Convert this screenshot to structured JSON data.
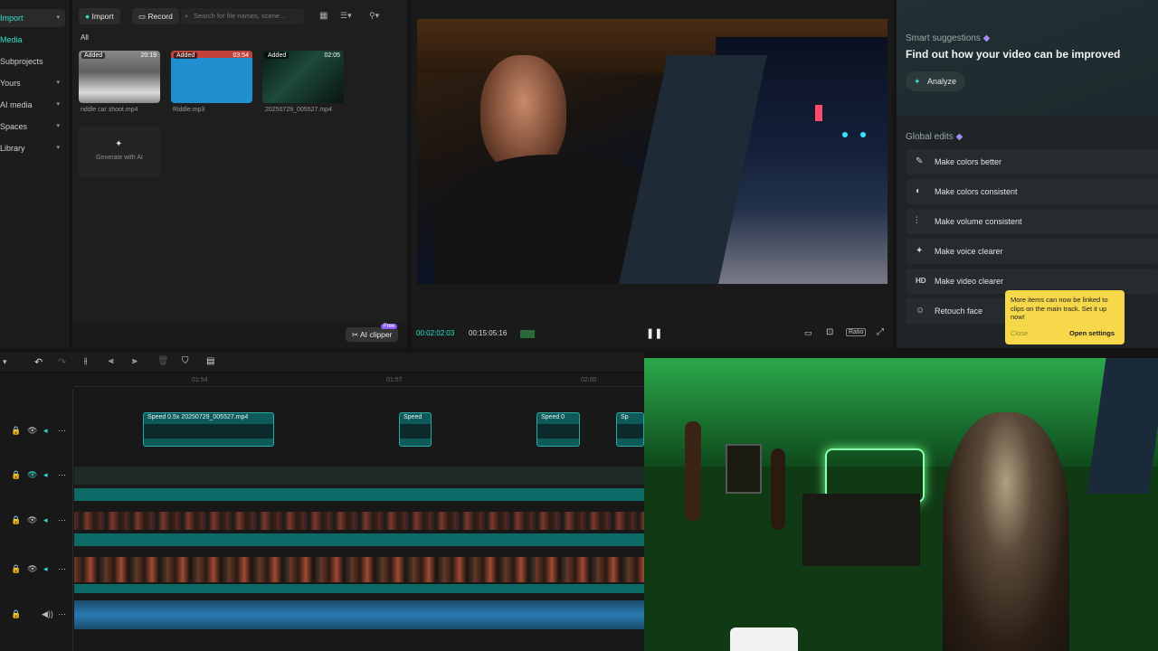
{
  "nav": {
    "items": [
      {
        "label": "Import",
        "active": true,
        "chevron": true
      },
      {
        "label": "Media",
        "active": false,
        "chevron": false
      },
      {
        "label": "Subprojects",
        "active": false,
        "chevron": false
      },
      {
        "label": "Yours",
        "active": false,
        "chevron": true
      },
      {
        "label": "AI media",
        "active": false,
        "chevron": true
      },
      {
        "label": "Spaces",
        "active": false,
        "chevron": true
      },
      {
        "label": "Library",
        "active": false,
        "chevron": true
      }
    ]
  },
  "media": {
    "import_label": "Import",
    "record_label": "Record",
    "search_placeholder": "Search for file names, scene...",
    "filter_all": "All",
    "files": [
      {
        "badge": "Added",
        "duration": "20:19",
        "name": "riddle car shoot.mp4"
      },
      {
        "badge": "Added",
        "duration": "03:54",
        "name": "Riddle.mp3"
      },
      {
        "badge": "Added",
        "duration": "02:05",
        "name": "20250729_005527.mp4"
      }
    ],
    "generate_label": "Generate with AI",
    "ai_clipper_label": "AI clipper",
    "free_badge": "Free"
  },
  "player": {
    "current_time": "00:02:02:03",
    "total_time": "00:15:05:16",
    "ratio_label": "Ratio"
  },
  "suggestions": {
    "heading": "Smart suggestions",
    "title": "Find out how your video can be improved",
    "analyze_label": "Analyze",
    "global_heading": "Global edits",
    "edits": [
      {
        "icon": "✎",
        "label": "Make colors better"
      },
      {
        "icon": "◐",
        "label": "Make colors consistent"
      },
      {
        "icon": "⫶",
        "label": "Make volume consistent"
      },
      {
        "icon": "✦",
        "label": "Make voice clearer"
      },
      {
        "icon": "HD",
        "label": "Make video clearer"
      },
      {
        "icon": "☺",
        "label": "Retouch face"
      }
    ]
  },
  "tooltip": {
    "text": "More items can now be linked to clips on the main track. Set it up now!",
    "close_label": "Close",
    "settings_label": "Open settings"
  },
  "timeline": {
    "ruler": [
      "01:54",
      "01:57",
      "02:00"
    ],
    "clip_labels": [
      "Speed 0.5x  20250729_005527.mp4",
      "Speed",
      "Speed 0",
      "Sp"
    ]
  },
  "colors": {
    "accent": "#2ee0d0",
    "tooltip": "#f6d84a",
    "clip": "#0e5a5a"
  }
}
